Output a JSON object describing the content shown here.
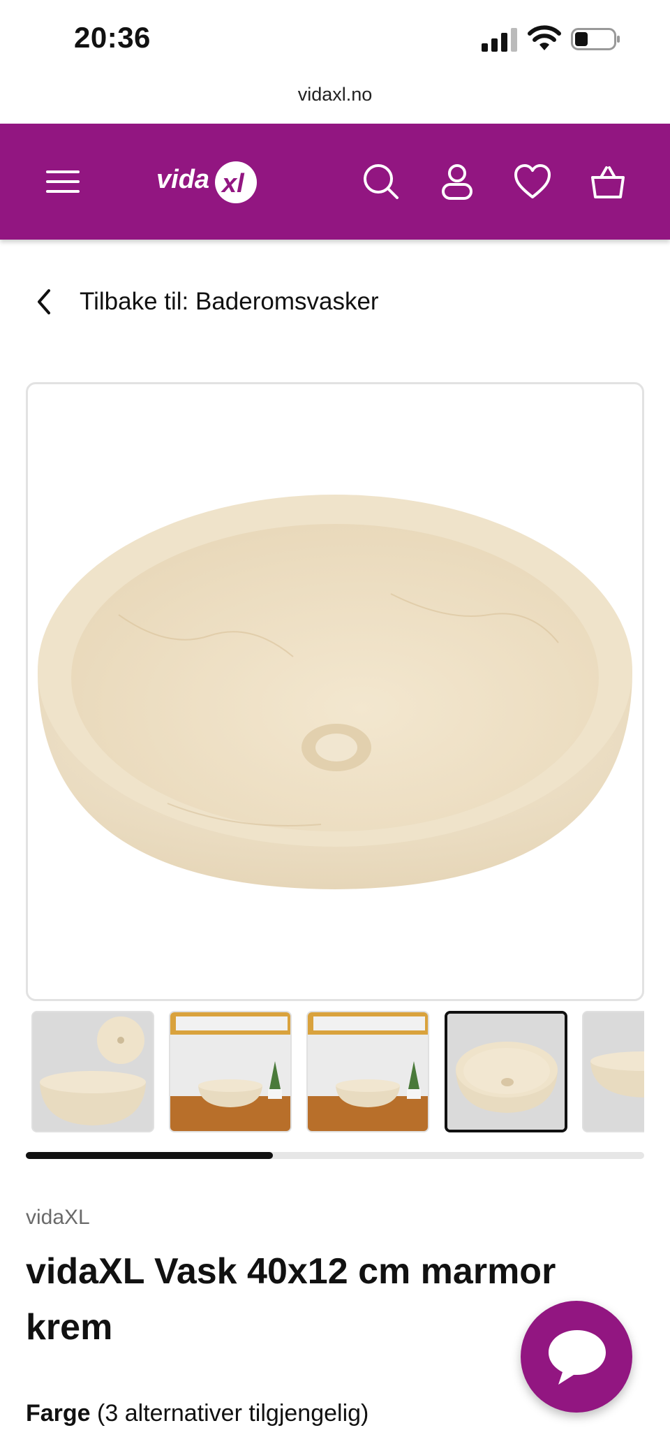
{
  "status_bar": {
    "time": "20:36"
  },
  "browser": {
    "url": "vidaxl.no"
  },
  "header": {
    "logo_text": "vidaXL",
    "brand_color": "#921681",
    "icons": [
      "menu-icon",
      "search-icon",
      "account-icon",
      "wishlist-icon",
      "cart-icon"
    ]
  },
  "breadcrumb": {
    "back_label": "Tilbake til: Baderomsvasker"
  },
  "gallery": {
    "thumbnails": [
      {
        "name": "sink-top-and-side-view"
      },
      {
        "name": "sink-bathroom-scene-1"
      },
      {
        "name": "sink-bathroom-scene-2"
      },
      {
        "name": "sink-angle-view",
        "selected": true
      },
      {
        "name": "sink-side-view"
      }
    ],
    "scroll_progress": 0.4
  },
  "product": {
    "brand": "vidaXL",
    "title": "vidaXL Vask 40x12 cm marmor krem",
    "color_label": "Farge",
    "color_options": "(3 alternativer tilgjengelig)"
  }
}
